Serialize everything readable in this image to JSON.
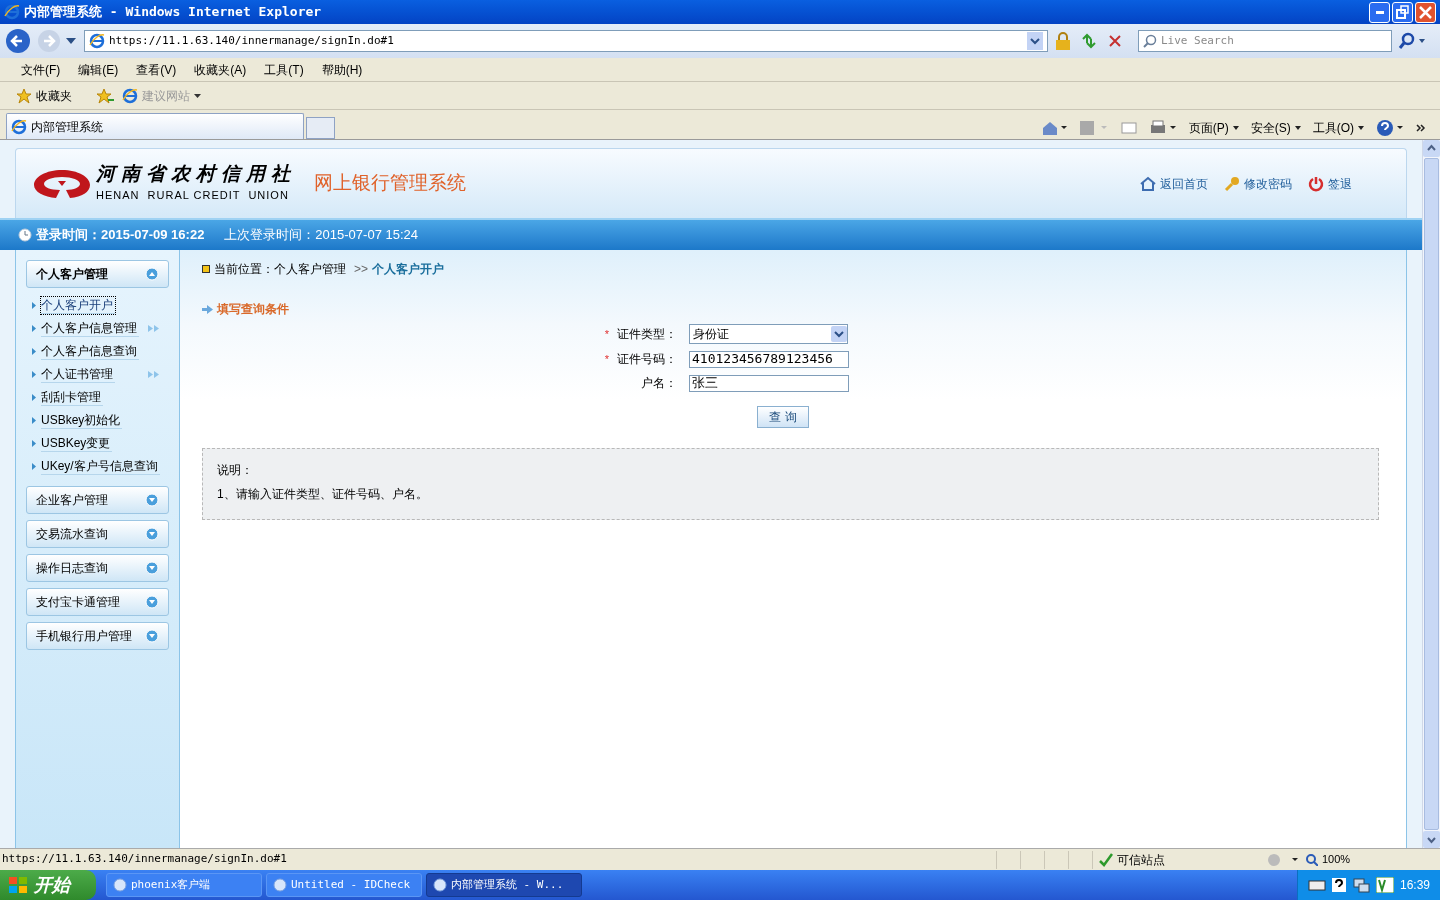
{
  "window": {
    "title": "内部管理系统 - Windows Internet Explorer"
  },
  "browser": {
    "address": "https://11.1.63.140/innermanage/signIn.do#1",
    "search_placeholder": "Live Search",
    "menu": [
      "文件(F)",
      "编辑(E)",
      "查看(V)",
      "收藏夹(A)",
      "工具(T)",
      "帮助(H)"
    ],
    "favorites_label": "收藏夹",
    "suggested_sites": "建议网站",
    "tabs": [
      {
        "label": "内部管理系统",
        "selected": true
      }
    ],
    "commands": [
      "页面(P)",
      "安全(S)",
      "工具(O)"
    ]
  },
  "page": {
    "brand_cn": "河南省农村信用社",
    "brand_en": "HENAN  RURAL CREDIT  UNION",
    "system_title": "网上银行管理系统",
    "header_links": [
      {
        "kind": "home",
        "label": "返回首页"
      },
      {
        "kind": "key",
        "label": "修改密码"
      },
      {
        "kind": "power",
        "label": "签退"
      }
    ],
    "login_time": "登录时间：2015-07-09 16:22",
    "last_login": "上次登录时间：2015-07-07 15:24",
    "sidebar": [
      {
        "label": "个人客户管理",
        "expanded": true,
        "children": [
          {
            "label": "个人客户开户",
            "selected": true,
            "has_submenu": false
          },
          {
            "label": "个人客户信息管理",
            "selected": false,
            "has_submenu": true
          },
          {
            "label": "个人客户信息查询",
            "selected": false,
            "has_submenu": false
          },
          {
            "label": "个人证书管理",
            "selected": false,
            "has_submenu": true
          },
          {
            "label": "刮刮卡管理",
            "selected": false,
            "has_submenu": false
          },
          {
            "label": "USBkey初始化",
            "selected": false,
            "has_submenu": false
          },
          {
            "label": "USBKey变更",
            "selected": false,
            "has_submenu": false
          },
          {
            "label": "UKey/客户号信息查询",
            "selected": false,
            "has_submenu": false
          }
        ]
      },
      {
        "label": "企业客户管理",
        "expanded": false
      },
      {
        "label": "交易流水查询",
        "expanded": false
      },
      {
        "label": "操作日志查询",
        "expanded": false
      },
      {
        "label": "支付宝卡通管理",
        "expanded": false
      },
      {
        "label": "手机银行用户管理",
        "expanded": false
      }
    ],
    "breadcrumb": {
      "prefix": "当前位置：个人客户管理",
      "separator": ">>",
      "current": "个人客户开户"
    },
    "section_title": "填写查询条件",
    "form": [
      {
        "required_mark": "*",
        "label": "证件类型：",
        "kind": "select",
        "value": "身份证"
      },
      {
        "required_mark": "*",
        "label": "证件号码：",
        "kind": "text",
        "value": "410123456789123456"
      },
      {
        "label": "户名：",
        "kind": "text",
        "value": "张三"
      }
    ],
    "query_button": "查 询",
    "note": {
      "title": "说明：",
      "text": "1、请输入证件类型、证件号码、户名。"
    }
  },
  "status_bar": {
    "url": "https://11.1.63.140/innermanage/signIn.do#1",
    "zone": "可信站点",
    "zoom": "100%"
  },
  "taskbar": {
    "start": "开始",
    "tasks": [
      {
        "label": "phoenix客户端",
        "selected": false
      },
      {
        "label": "Untitled - IDCheck",
        "selected": false
      },
      {
        "label": "内部管理系统 - W...",
        "selected": true
      }
    ],
    "clock": "16:39"
  }
}
